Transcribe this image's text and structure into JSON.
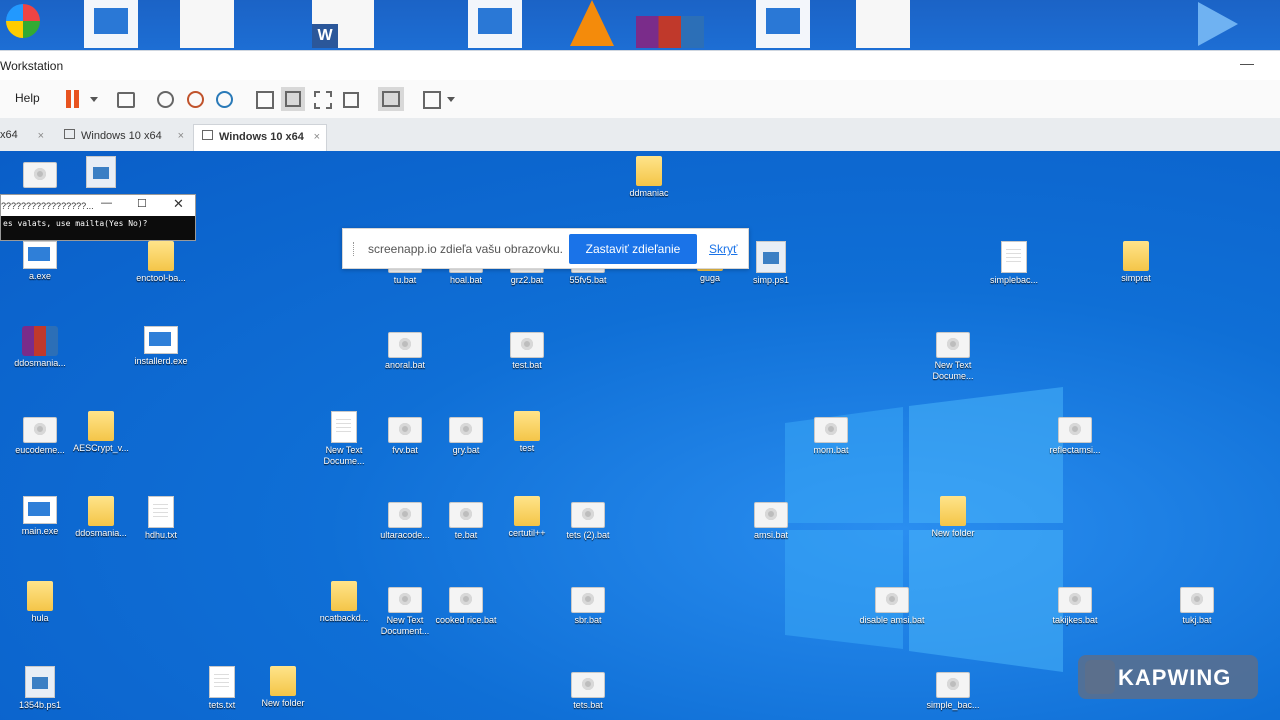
{
  "window": {
    "title": "Workstation",
    "minimize_glyph": "—"
  },
  "toolbar": {
    "help_label": "Help",
    "pause_color": "#e8531f",
    "icons": [
      "pause-icon",
      "dropdown-icon",
      "send-ctrl-alt-del-icon",
      "snapshot-icon",
      "revert-snapshot-icon",
      "snapshot-manager-icon",
      "library-view-icon",
      "thumbnail-view-icon",
      "fullscreen-icon",
      "unity-icon",
      "console-view-icon",
      "stretch-icon"
    ]
  },
  "tabs": [
    {
      "label": "x64",
      "close": "×"
    },
    {
      "label": "Windows 10 x64",
      "close": "×"
    },
    {
      "label": "Windows 10 x64",
      "close": "×",
      "active": true
    }
  ],
  "console_window": {
    "title": "?????????????????...",
    "min": "—",
    "max": "☐",
    "close": "✕",
    "text": "es valats, use mailta(Yes No)?"
  },
  "share_bar": {
    "message": "screenapp.io zdieľa vašu obrazovku.",
    "stop_label": "Zastaviť zdieľanie",
    "hide_label": "Skryť"
  },
  "desktop_icons": [
    {
      "label": "",
      "type": "bat"
    },
    {
      "label": "",
      "type": "ps"
    },
    {
      "label": "ddmaniac",
      "type": "folder"
    },
    {
      "label": "a.exe",
      "type": "exe"
    },
    {
      "label": "enctool-ba...",
      "type": "folder"
    },
    {
      "label": "tu.bat",
      "type": "bat"
    },
    {
      "label": "hoal.bat",
      "type": "bat"
    },
    {
      "label": "grz2.bat",
      "type": "bat"
    },
    {
      "label": "55fv5.bat",
      "type": "bat"
    },
    {
      "label": "guga",
      "type": "folder"
    },
    {
      "label": "simp.ps1",
      "type": "ps"
    },
    {
      "label": "simplebac...",
      "type": "txt"
    },
    {
      "label": "simprat",
      "type": "folder"
    },
    {
      "label": "ddosmania...",
      "type": "rar"
    },
    {
      "label": "installerd.exe",
      "type": "exe"
    },
    {
      "label": "anoral.bat",
      "type": "bat"
    },
    {
      "label": "test.bat",
      "type": "bat"
    },
    {
      "label": "New Text Docume...",
      "type": "bat"
    },
    {
      "label": "eucodeme...",
      "type": "bat"
    },
    {
      "label": "AESCrypt_v...",
      "type": "folder"
    },
    {
      "label": "New Text Docume...",
      "type": "txt"
    },
    {
      "label": "fvv.bat",
      "type": "bat"
    },
    {
      "label": "gry.bat",
      "type": "bat"
    },
    {
      "label": "test",
      "type": "folder"
    },
    {
      "label": "mom.bat",
      "type": "bat"
    },
    {
      "label": "reflectamsi...",
      "type": "bat"
    },
    {
      "label": "main.exe",
      "type": "exe"
    },
    {
      "label": "ddosmania...",
      "type": "folder"
    },
    {
      "label": "hdhu.txt",
      "type": "txt"
    },
    {
      "label": "ultaracode...",
      "type": "bat"
    },
    {
      "label": "te.bat",
      "type": "bat"
    },
    {
      "label": "certutil++",
      "type": "folder"
    },
    {
      "label": "tets (2).bat",
      "type": "bat"
    },
    {
      "label": "amsi.bat",
      "type": "bat"
    },
    {
      "label": "New folder",
      "type": "folder"
    },
    {
      "label": "hula",
      "type": "folder"
    },
    {
      "label": "ncatbackd...",
      "type": "folder"
    },
    {
      "label": "New Text Document...",
      "type": "bat"
    },
    {
      "label": "cooked rice.bat",
      "type": "bat"
    },
    {
      "label": "sbr.bat",
      "type": "bat"
    },
    {
      "label": "disable amsi.bat",
      "type": "bat"
    },
    {
      "label": "takijkes.bat",
      "type": "bat"
    },
    {
      "label": "tukj.bat",
      "type": "bat"
    },
    {
      "label": "1354b.ps1",
      "type": "ps"
    },
    {
      "label": "tets.txt",
      "type": "txt"
    },
    {
      "label": "New folder",
      "type": "folder"
    },
    {
      "label": "tets.bat",
      "type": "bat"
    },
    {
      "label": "simple_bac...",
      "type": "bat"
    }
  ],
  "watermark": {
    "label": "KAPWING"
  },
  "colors": {
    "desktop": "#0f6fd6",
    "share_button": "#1a73e8"
  }
}
